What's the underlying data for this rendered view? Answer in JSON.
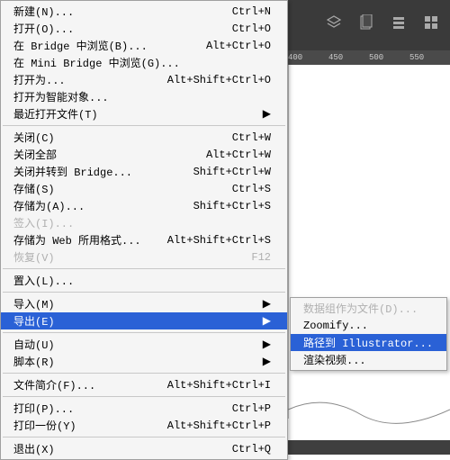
{
  "ruler": [
    "400",
    "450",
    "500",
    "550"
  ],
  "menu": {
    "g1": [
      {
        "label": "新建(N)...",
        "shortcut": "Ctrl+N"
      },
      {
        "label": "打开(O)...",
        "shortcut": "Ctrl+O"
      },
      {
        "label": "在 Bridge 中浏览(B)...",
        "shortcut": "Alt+Ctrl+O"
      },
      {
        "label": "在 Mini Bridge 中浏览(G)...",
        "shortcut": ""
      },
      {
        "label": "打开为...",
        "shortcut": "Alt+Shift+Ctrl+O"
      },
      {
        "label": "打开为智能对象...",
        "shortcut": ""
      },
      {
        "label": "最近打开文件(T)",
        "shortcut": "",
        "submenu": true
      }
    ],
    "g2": [
      {
        "label": "关闭(C)",
        "shortcut": "Ctrl+W"
      },
      {
        "label": "关闭全部",
        "shortcut": "Alt+Ctrl+W"
      },
      {
        "label": "关闭并转到 Bridge...",
        "shortcut": "Shift+Ctrl+W"
      },
      {
        "label": "存储(S)",
        "shortcut": "Ctrl+S"
      },
      {
        "label": "存储为(A)...",
        "shortcut": "Shift+Ctrl+S"
      },
      {
        "label": "签入(I)...",
        "shortcut": "",
        "disabled": true
      },
      {
        "label": "存储为 Web 所用格式...",
        "shortcut": "Alt+Shift+Ctrl+S"
      },
      {
        "label": "恢复(V)",
        "shortcut": "F12",
        "disabled": true
      }
    ],
    "g3": [
      {
        "label": "置入(L)...",
        "shortcut": ""
      }
    ],
    "g4": [
      {
        "label": "导入(M)",
        "shortcut": "",
        "submenu": true
      },
      {
        "label": "导出(E)",
        "shortcut": "",
        "submenu": true,
        "highlight": true
      }
    ],
    "g5": [
      {
        "label": "自动(U)",
        "shortcut": "",
        "submenu": true
      },
      {
        "label": "脚本(R)",
        "shortcut": "",
        "submenu": true
      }
    ],
    "g6": [
      {
        "label": "文件简介(F)...",
        "shortcut": "Alt+Shift+Ctrl+I"
      }
    ],
    "g7": [
      {
        "label": "打印(P)...",
        "shortcut": "Ctrl+P"
      },
      {
        "label": "打印一份(Y)",
        "shortcut": "Alt+Shift+Ctrl+P"
      }
    ],
    "g8": [
      {
        "label": "退出(X)",
        "shortcut": "Ctrl+Q"
      }
    ]
  },
  "submenu": [
    {
      "label": "数据组作为文件(D)...",
      "disabled": true
    },
    {
      "label": "Zoomify..."
    },
    {
      "label": "路径到 Illustrator...",
      "highlight": true
    },
    {
      "label": "渲染视频..."
    }
  ]
}
